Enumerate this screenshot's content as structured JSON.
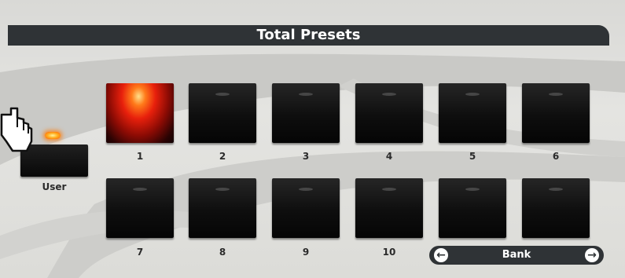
{
  "title": "Total Presets",
  "user": {
    "label": "User",
    "led": "on"
  },
  "presets": [
    {
      "number": "1",
      "active": true
    },
    {
      "number": "2",
      "active": false
    },
    {
      "number": "3",
      "active": false
    },
    {
      "number": "4",
      "active": false
    },
    {
      "number": "5",
      "active": false
    },
    {
      "number": "6",
      "active": false
    },
    {
      "number": "7",
      "active": false
    },
    {
      "number": "8",
      "active": false
    },
    {
      "number": "9",
      "active": false
    },
    {
      "number": "10",
      "active": false
    },
    {
      "number": "",
      "active": false
    },
    {
      "number": "",
      "active": false
    }
  ],
  "bank": {
    "label": "Bank",
    "left_icon": "arrow-left-icon",
    "right_icon": "arrow-right-icon"
  },
  "colors": {
    "panel": "#dcdcd8",
    "bar": "#2f3336",
    "pad": "#0e0e0e",
    "active_pad": "#e8200c",
    "led": "#ffb020"
  }
}
